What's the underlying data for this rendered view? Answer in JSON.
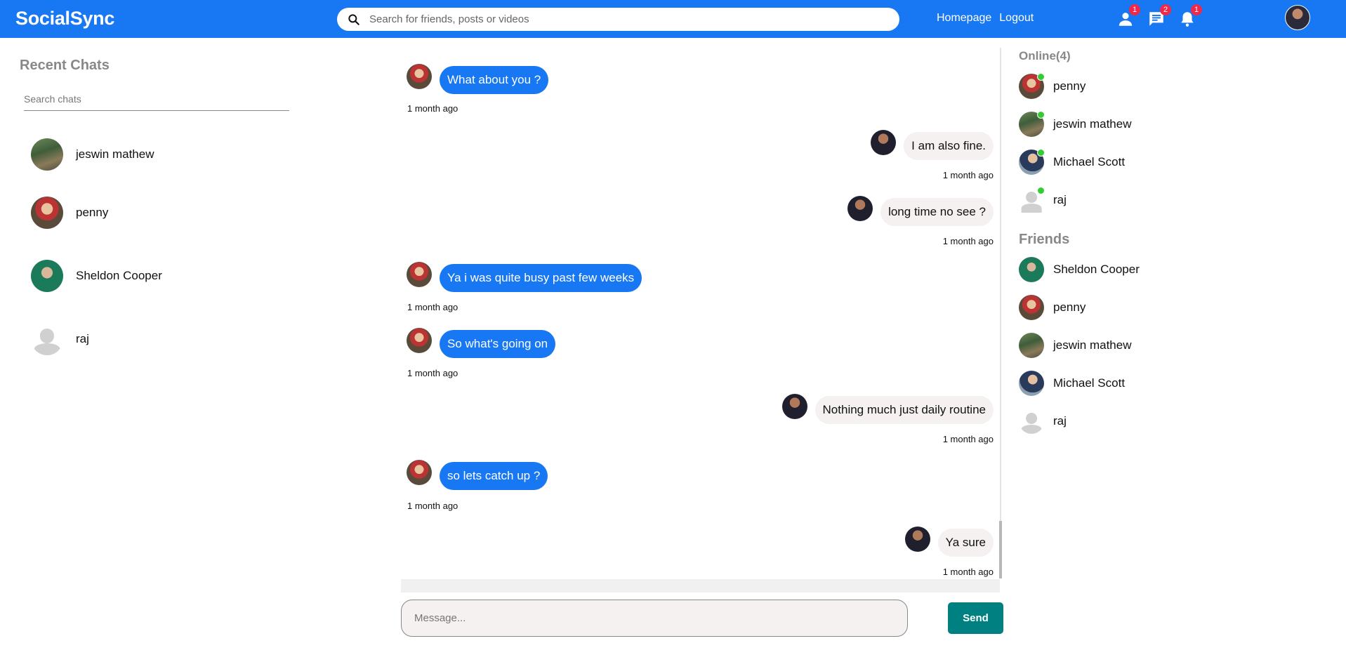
{
  "app": {
    "name": "SocialSync"
  },
  "search": {
    "placeholder": "Search for friends, posts or videos"
  },
  "nav": {
    "homepage": "Homepage",
    "logout": "Logout"
  },
  "notifications": {
    "friend_requests": "1",
    "messages": "2",
    "alerts": "1"
  },
  "left": {
    "title": "Recent Chats",
    "search_placeholder": "Search chats",
    "conversations": [
      {
        "name": "jeswin mathew",
        "avatar": "jeswin"
      },
      {
        "name": "penny",
        "avatar": "penny"
      },
      {
        "name": "Sheldon Cooper",
        "avatar": "sheldon"
      },
      {
        "name": "raj",
        "avatar": "default"
      }
    ]
  },
  "chat": {
    "messages": [
      {
        "from": "them",
        "text": "What about you ?",
        "time": "1 month ago"
      },
      {
        "from": "me",
        "text": "I am also fine.",
        "time": "1 month ago"
      },
      {
        "from": "me",
        "text": "long time no see ?",
        "time": "1 month ago"
      },
      {
        "from": "them",
        "text": "Ya i was quite busy past few weeks",
        "time": "1 month ago"
      },
      {
        "from": "them",
        "text": "So what's going on",
        "time": "1 month ago"
      },
      {
        "from": "me",
        "text": "Nothing much just daily routine",
        "time": "1 month ago"
      },
      {
        "from": "them",
        "text": "so lets catch up ?",
        "time": "1 month ago"
      },
      {
        "from": "me",
        "text": "Ya sure",
        "time": "1 month ago"
      }
    ],
    "input_placeholder": "Message...",
    "send_label": "Send"
  },
  "right": {
    "online_title": "Online(4)",
    "online": [
      {
        "name": "penny",
        "avatar": "penny"
      },
      {
        "name": "jeswin mathew",
        "avatar": "jeswin"
      },
      {
        "name": "Michael Scott",
        "avatar": "michael"
      },
      {
        "name": "raj",
        "avatar": "default"
      }
    ],
    "friends_title": "Friends",
    "friends": [
      {
        "name": "Sheldon Cooper",
        "avatar": "sheldon"
      },
      {
        "name": "penny",
        "avatar": "penny"
      },
      {
        "name": "jeswin mathew",
        "avatar": "jeswin"
      },
      {
        "name": "Michael Scott",
        "avatar": "michael"
      },
      {
        "name": "raj",
        "avatar": "default"
      }
    ]
  },
  "colors": {
    "brand": "#1877f2",
    "send": "#008080",
    "online": "#32cd32",
    "badge": "#f02849"
  }
}
